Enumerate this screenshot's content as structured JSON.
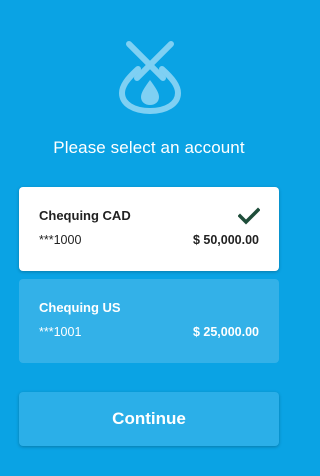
{
  "header": {
    "logo_icon": "droplet-pendant-logo",
    "prompt": "Please select an account"
  },
  "accounts": [
    {
      "name": "Chequing CAD",
      "number": "***1000",
      "balance": "$ 50,000.00",
      "selected": true,
      "selected_icon": "checkmark-icon"
    },
    {
      "name": "Chequing US",
      "number": "***1001",
      "balance": "$ 25,000.00",
      "selected": false
    }
  ],
  "actions": {
    "continue_label": "Continue"
  },
  "colors": {
    "background": "#0aa3e4",
    "selected_card": "#ffffff",
    "unselected_card": "#33b1e8",
    "check": "#1e4d3a",
    "button": "#2bafe8"
  }
}
